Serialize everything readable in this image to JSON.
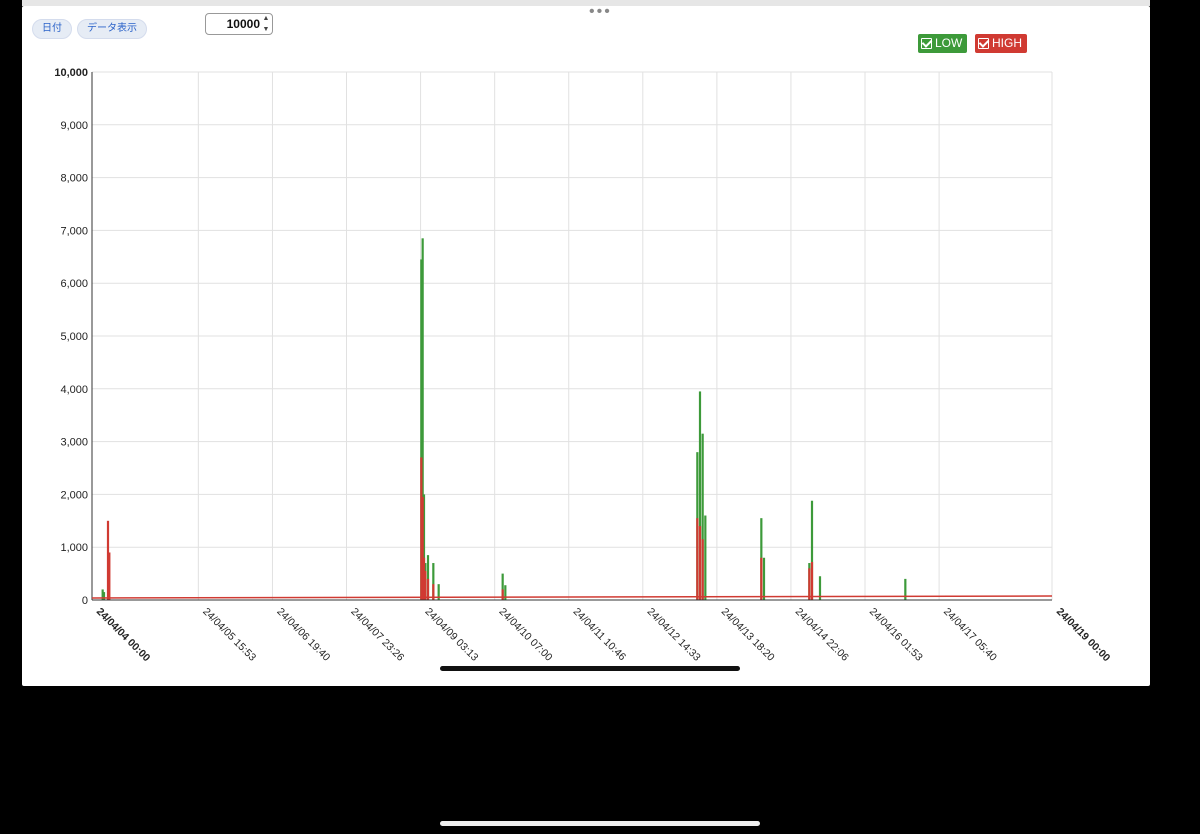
{
  "toolbar": {
    "date_button": "日付",
    "data_button": "データ表示",
    "stepper_value": "10000"
  },
  "legend": [
    {
      "label": "LOW",
      "color": "#3d9a3a"
    },
    {
      "label": "HIGH",
      "color": "#d03a32"
    }
  ],
  "chart_data": {
    "type": "area",
    "ylim": [
      0,
      10000
    ],
    "yticks": [
      "0",
      "1,000",
      "2,000",
      "3,000",
      "4,000",
      "5,000",
      "6,000",
      "7,000",
      "8,000",
      "9,000",
      "10,000"
    ],
    "xlim": [
      "24/04/04 00:00",
      "24/04/19 00:00"
    ],
    "xticks": [
      "24/04/04 00:00",
      "24/04/05 15:53",
      "24/04/06 19:40",
      "24/04/07 23:26",
      "24/04/09 03:13",
      "24/04/10 07:00",
      "24/04/11 10:46",
      "24/04/12 14:33",
      "24/04/13 18:20",
      "24/04/14 22:06",
      "24/04/16 01:53",
      "24/04/17 05:40",
      "24/04/19 00:00"
    ],
    "grid": true,
    "legend_position": "top-right",
    "series": [
      {
        "name": "LOW",
        "color": "#3d9a3a",
        "x": [
          "24/04/04 04:00",
          "24/04/04 04:30",
          "24/04/09 03:30",
          "24/04/09 04:00",
          "24/04/09 04:30",
          "24/04/09 05:00",
          "24/04/09 06:00",
          "24/04/09 08:00",
          "24/04/09 10:00",
          "24/04/10 10:00",
          "24/04/10 11:00",
          "24/04/13 11:00",
          "24/04/13 12:00",
          "24/04/13 13:00",
          "24/04/13 14:00",
          "24/04/14 11:00",
          "24/04/14 12:00",
          "24/04/15 05:00",
          "24/04/15 06:00",
          "24/04/15 09:00",
          "24/04/16 17:00"
        ],
        "y": [
          200,
          150,
          6450,
          6850,
          2000,
          700,
          850,
          700,
          300,
          500,
          280,
          2800,
          3950,
          3150,
          1600,
          1550,
          800,
          700,
          1880,
          450,
          400
        ]
      },
      {
        "name": "HIGH",
        "color": "#d03a32",
        "x": [
          "24/04/04 06:00",
          "24/04/04 06:30",
          "24/04/09 03:30",
          "24/04/09 04:00",
          "24/04/09 04:30",
          "24/04/09 05:00",
          "24/04/09 06:00",
          "24/04/09 08:00",
          "24/04/10 10:00",
          "24/04/13 11:00",
          "24/04/13 12:00",
          "24/04/13 13:00",
          "24/04/14 11:00",
          "24/04/15 05:00",
          "24/04/15 06:00"
        ],
        "y": [
          1500,
          900,
          2700,
          1950,
          800,
          550,
          400,
          300,
          200,
          1550,
          1400,
          1150,
          800,
          600,
          720
        ]
      }
    ]
  }
}
